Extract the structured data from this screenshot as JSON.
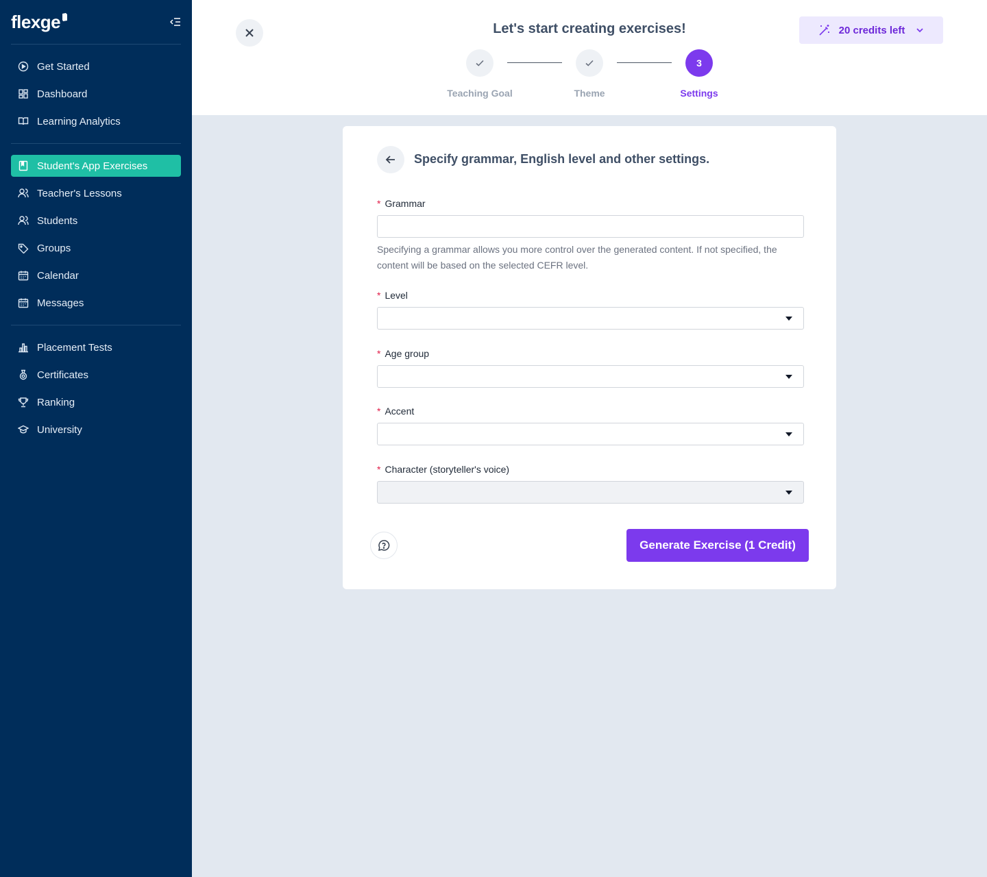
{
  "sidebar": {
    "logo_text": "flexge",
    "groups": [
      {
        "items": [
          {
            "label": "Get Started",
            "icon": "play-circle-icon"
          },
          {
            "label": "Dashboard",
            "icon": "dashboard-grid-icon"
          },
          {
            "label": "Learning Analytics",
            "icon": "open-book-icon"
          }
        ]
      },
      {
        "items": [
          {
            "label": "Student's App Exercises",
            "icon": "bookmark-book-icon",
            "active": true
          },
          {
            "label": "Teacher's Lessons",
            "icon": "user-icon"
          },
          {
            "label": "Students",
            "icon": "users-icon"
          },
          {
            "label": "Groups",
            "icon": "tag-icon"
          },
          {
            "label": "Calendar",
            "icon": "calendar-icon"
          },
          {
            "label": "Messages",
            "icon": "calendar-message-icon"
          }
        ]
      },
      {
        "items": [
          {
            "label": "Placement Tests",
            "icon": "bar-chart-icon"
          },
          {
            "label": "Certificates",
            "icon": "medal-icon"
          },
          {
            "label": "Ranking",
            "icon": "trophy-icon"
          },
          {
            "label": "University",
            "icon": "graduation-cap-icon"
          }
        ]
      }
    ]
  },
  "header": {
    "title": "Let's start creating exercises!",
    "credits_label": "20 credits left",
    "steps": [
      {
        "label": "Teaching Goal",
        "state": "done"
      },
      {
        "label": "Theme",
        "state": "done"
      },
      {
        "label": "Settings",
        "state": "current",
        "number": "3"
      }
    ]
  },
  "card": {
    "title": "Specify grammar, English level and other settings.",
    "fields": {
      "grammar": {
        "label": "Grammar",
        "value": "",
        "help": "Specifying a grammar allows you more control over the generated content. If not specified, the content will be based on the selected CEFR level."
      },
      "level": {
        "label": "Level",
        "value": ""
      },
      "age_group": {
        "label": "Age group",
        "value": ""
      },
      "accent": {
        "label": "Accent",
        "value": ""
      },
      "character": {
        "label": "Character (storyteller's voice)",
        "value": ""
      }
    },
    "generate_label": "Generate Exercise (1 Credit)"
  },
  "colors": {
    "sidebar_bg": "#002d5a",
    "active_item": "#1fbfa5",
    "accent_purple": "#7c3aed",
    "page_bg": "#e2e8f0"
  }
}
